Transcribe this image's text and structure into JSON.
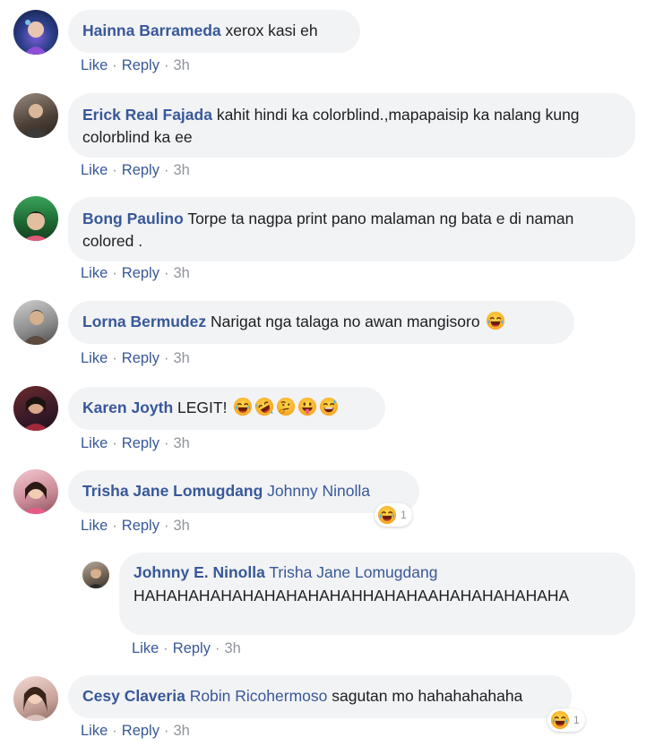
{
  "actions": {
    "like": "Like",
    "reply": "Reply",
    "separator": "·"
  },
  "comments": [
    {
      "author": "Hainna Barrameda",
      "text": "xerox kasi eh",
      "time": "3h"
    },
    {
      "author": "Erick Real Fajada",
      "text": "kahit hindi ka colorblind.,mapapaisip ka nalang kung colorblind ka ee",
      "time": "3h"
    },
    {
      "author": "Bong Paulino",
      "text": "Torpe ta nagpa print pano malaman ng bata e di naman colored .",
      "time": "3h"
    },
    {
      "author": "Lorna Bermudez",
      "text": "Narigat nga talaga no awan mangisoro",
      "time": "3h"
    },
    {
      "author": "Karen Joyth",
      "text": "LEGIT!",
      "time": "3h"
    },
    {
      "author": "Trisha Jane Lomugdang",
      "mention": "Johnny Ninolla",
      "text": "",
      "time": "3h",
      "reaction_count": "1"
    },
    {
      "author": "Johnny E. Ninolla",
      "mention": "Trisha Jane Lomugdang",
      "text": "HAHAHAHAHAHAHAHAHAHAHHAHAHAAHAHAHAHAHAHA",
      "time": "3h"
    },
    {
      "author": "Cesy Claveria",
      "mention": "Robin Ricohermoso",
      "text": "sagutan mo hahahahahaha",
      "time": "3h",
      "reaction_count": "1"
    }
  ],
  "icons": {
    "emoji_laughing": "face-with-tears-of-joy-icon",
    "emoji_rofl": "rolling-on-floor-laughing-icon",
    "emoji_thinking": "thinking-face-icon",
    "emoji_tongue": "face-with-tongue-icon",
    "emoji_sweat": "grinning-sweat-icon"
  },
  "colors": {
    "author": "#385898",
    "bubble": "#f2f3f5",
    "muted": "#90949c"
  }
}
